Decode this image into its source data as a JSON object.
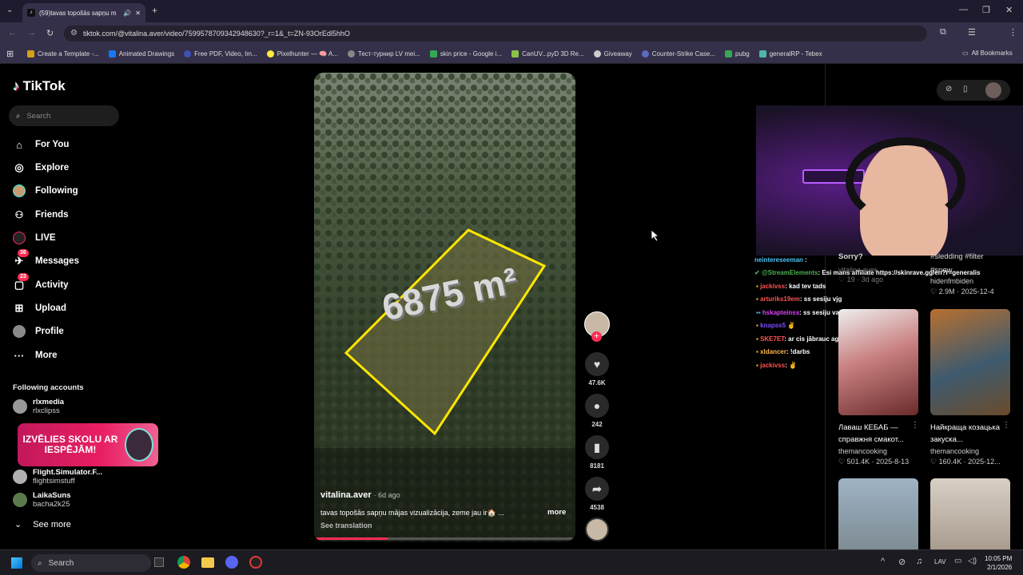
{
  "browser": {
    "tab_title": "(59)tavas topošās sapņu m",
    "url": "tiktok.com/@vitalina.aver/video/7599578709342948630?_r=1&_t=ZN-93OrEdl5hhO",
    "bookmarks": [
      "Create a Template -...",
      "Animated Drawings",
      "Free PDF, Video, Im...",
      "Pixelhunter — 🧠 A...",
      "Тест-турнир LV mei...",
      "skin price - Google i...",
      "CanUV...pyD 3D Re...",
      "Giveaway",
      "Counter-Strike Case...",
      "pubg",
      "generalRP - Tebex"
    ],
    "all_bookmarks": "All Bookmarks"
  },
  "tiktok": {
    "logo": "TikTok",
    "search_placeholder": "Search",
    "nav": [
      {
        "label": "For You",
        "icon": "home-icon",
        "glyph": "⌂"
      },
      {
        "label": "Explore",
        "icon": "compass-icon",
        "glyph": "◎"
      },
      {
        "label": "Following",
        "icon": "following-avatar-icon",
        "glyph": "●"
      },
      {
        "label": "Friends",
        "icon": "friends-icon",
        "glyph": "👥"
      },
      {
        "label": "LIVE",
        "icon": "live-icon",
        "glyph": "◉"
      },
      {
        "label": "Messages",
        "icon": "messages-icon",
        "glyph": "✉",
        "badge": "36"
      },
      {
        "label": "Activity",
        "icon": "activity-icon",
        "glyph": "☐",
        "badge": "23"
      },
      {
        "label": "Upload",
        "icon": "upload-icon",
        "glyph": "⊞"
      },
      {
        "label": "Profile",
        "icon": "profile-icon",
        "glyph": "●"
      },
      {
        "label": "More",
        "icon": "more-icon",
        "glyph": "···"
      }
    ],
    "following_header": "Following accounts",
    "accounts": [
      {
        "name": "rlxmedia",
        "handle": "rlxclipss"
      },
      {
        "name": "Flight.Simulator.F...",
        "handle": "flightsimstuff"
      },
      {
        "name": "LaikaSuns",
        "handle": "bacha2k25"
      }
    ],
    "see_more": "See more",
    "promo": "IZVĒLIES SKOLU AR IESPĒJĀM!",
    "video": {
      "overlay_area": "6875 m²",
      "author": "vitalina.aver",
      "age": "· 6d ago",
      "caption": "tavas topošās sapņu mājas vizualizācija, zeme jau ir🏠 ...",
      "more": "more",
      "translate": "See translation",
      "likes": "47.6K",
      "comments": "242",
      "saves": "8181",
      "shares": "4538"
    }
  },
  "chat": [
    {
      "user": "neintereseeman",
      "msg": "",
      "color": "#4fc3f7"
    },
    {
      "user": "@StreamElements",
      "msg": ": Esi mans affiliate https://skinrave.gg/en?r=generalis",
      "color": "#4caf50"
    },
    {
      "user": "jackivss",
      "msg": ": kad tev tads",
      "color": "#ff5252"
    },
    {
      "user": "arturiks19em",
      "msg": ": ss sesiju vjg",
      "color": "#ff5252"
    },
    {
      "user": "hskapteinss",
      "msg": ": ss sesiju vajag",
      "color": "#e040fb"
    },
    {
      "user": "knapss5",
      "msg": "",
      "color": "#7c4dff"
    },
    {
      "user": "SKE7ET",
      "msg": ": ar cis jābrauc aggresivi",
      "color": "#ff5252"
    },
    {
      "user": "xldancer",
      "msg": ": !darbs",
      "color": "#ffb74d"
    },
    {
      "user": "jackivss",
      "msg": ":",
      "color": "#ff5252"
    }
  ],
  "behind_stream": {
    "left_title": "Sorry?",
    "left_user": "vitalina.aver",
    "left_stats": "♡ 19 · 3d ago",
    "right_title": "#sledding #filter",
    "right_sub": "#snow",
    "right_user": "hidenfmbiden",
    "right_stats": "♡ 2.9M · 2025-12-4"
  },
  "cards": [
    {
      "title": "Лаваш КЕБАБ — справжня смакот...",
      "user": "themancooking",
      "stats": "♡ 501.4K · 2025-8-13"
    },
    {
      "title": "Найкраща козацька закуска...",
      "user": "themancooking",
      "stats": "♡ 160.4K · 2025-12..."
    }
  ],
  "taskbar": {
    "search": "Search",
    "lang": "LAV",
    "time": "10:05 PM",
    "date": "2/1/2026"
  }
}
